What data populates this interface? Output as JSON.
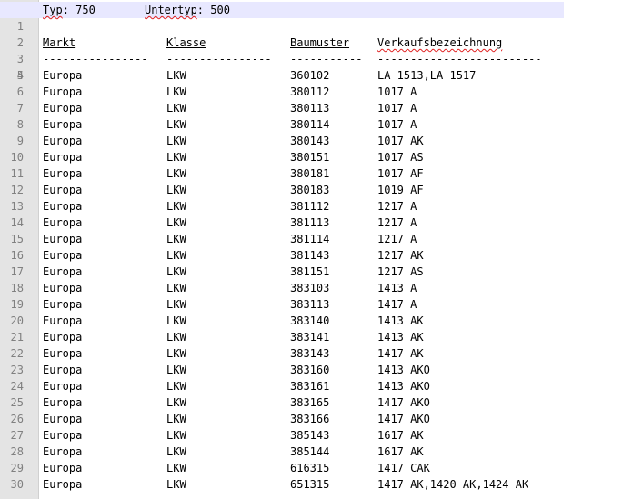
{
  "header": {
    "typ_label": "Typ",
    "typ_value": ": 750",
    "untertyp_label": "Untertyp",
    "untertyp_value": ": 500"
  },
  "columns": {
    "markt": "Markt",
    "klasse": "Klasse",
    "baumuster": "Baumuster",
    "verkaufsbezeichnung": "Verkaufsbezeichnung"
  },
  "separators": {
    "markt": "----------------",
    "klasse": "----------------",
    "baumuster": "-----------",
    "verkaufsbezeichnung": "-------------------------"
  },
  "line_numbers": [
    "1",
    "2",
    "3",
    "4",
    "5",
    "6",
    "7",
    "8",
    "9",
    "10",
    "11",
    "12",
    "13",
    "14",
    "15",
    "16",
    "17",
    "18",
    "19",
    "20",
    "21",
    "22",
    "23",
    "24",
    "25",
    "26",
    "27",
    "28",
    "29",
    "30"
  ],
  "rows": [
    {
      "markt": "Europa",
      "klasse": "LKW",
      "baumuster": "360102",
      "bez": "LA 1513,LA 1517"
    },
    {
      "markt": "Europa",
      "klasse": "LKW",
      "baumuster": "380112",
      "bez": "1017 A"
    },
    {
      "markt": "Europa",
      "klasse": "LKW",
      "baumuster": "380113",
      "bez": "1017 A"
    },
    {
      "markt": "Europa",
      "klasse": "LKW",
      "baumuster": "380114",
      "bez": "1017 A"
    },
    {
      "markt": "Europa",
      "klasse": "LKW",
      "baumuster": "380143",
      "bez": "1017 AK"
    },
    {
      "markt": "Europa",
      "klasse": "LKW",
      "baumuster": "380151",
      "bez": "1017 AS"
    },
    {
      "markt": "Europa",
      "klasse": "LKW",
      "baumuster": "380181",
      "bez": "1017 AF"
    },
    {
      "markt": "Europa",
      "klasse": "LKW",
      "baumuster": "380183",
      "bez": "1019 AF"
    },
    {
      "markt": "Europa",
      "klasse": "LKW",
      "baumuster": "381112",
      "bez": "1217 A"
    },
    {
      "markt": "Europa",
      "klasse": "LKW",
      "baumuster": "381113",
      "bez": "1217 A"
    },
    {
      "markt": "Europa",
      "klasse": "LKW",
      "baumuster": "381114",
      "bez": "1217 A"
    },
    {
      "markt": "Europa",
      "klasse": "LKW",
      "baumuster": "381143",
      "bez": "1217 AK"
    },
    {
      "markt": "Europa",
      "klasse": "LKW",
      "baumuster": "381151",
      "bez": "1217 AS"
    },
    {
      "markt": "Europa",
      "klasse": "LKW",
      "baumuster": "383103",
      "bez": "1413 A"
    },
    {
      "markt": "Europa",
      "klasse": "LKW",
      "baumuster": "383113",
      "bez": "1417 A"
    },
    {
      "markt": "Europa",
      "klasse": "LKW",
      "baumuster": "383140",
      "bez": "1413 AK"
    },
    {
      "markt": "Europa",
      "klasse": "LKW",
      "baumuster": "383141",
      "bez": "1413 AK"
    },
    {
      "markt": "Europa",
      "klasse": "LKW",
      "baumuster": "383143",
      "bez": "1417 AK"
    },
    {
      "markt": "Europa",
      "klasse": "LKW",
      "baumuster": "383160",
      "bez": "1413 AKO"
    },
    {
      "markt": "Europa",
      "klasse": "LKW",
      "baumuster": "383161",
      "bez": "1413 AKO"
    },
    {
      "markt": "Europa",
      "klasse": "LKW",
      "baumuster": "383165",
      "bez": "1417 AKO"
    },
    {
      "markt": "Europa",
      "klasse": "LKW",
      "baumuster": "383166",
      "bez": "1417 AKO"
    },
    {
      "markt": "Europa",
      "klasse": "LKW",
      "baumuster": "385143",
      "bez": "1617 AK"
    },
    {
      "markt": "Europa",
      "klasse": "LKW",
      "baumuster": "385144",
      "bez": "1617 AK"
    },
    {
      "markt": "Europa",
      "klasse": "LKW",
      "baumuster": "616315",
      "bez": "1417 CAK"
    },
    {
      "markt": "Europa",
      "klasse": "LKW",
      "baumuster": "651315",
      "bez": "1417 AK,1420 AK,1424 AK"
    }
  ]
}
